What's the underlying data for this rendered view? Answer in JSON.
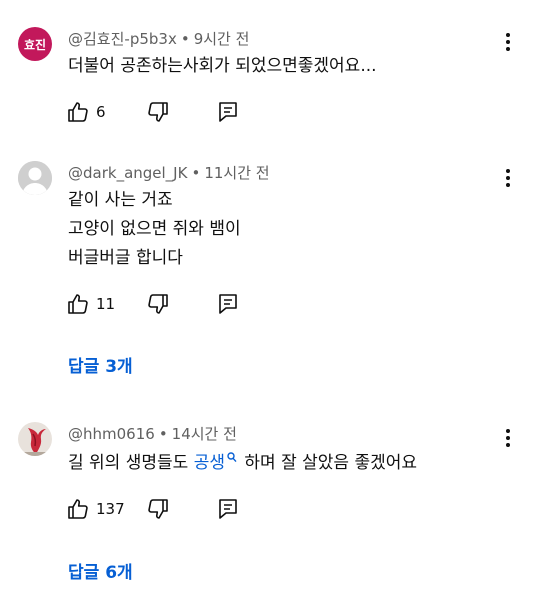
{
  "comments": [
    {
      "avatar_text": "효진",
      "author": "@김효진-p5b3x",
      "time": "9시간 전",
      "lines": [
        "더불어 공존하는사회가 되었으면좋겠어요..."
      ],
      "likes": "6"
    },
    {
      "author": "@dark_angel_JK",
      "time": "11시간 전",
      "lines": [
        "같이 사는 거죠",
        "고양이 없으면 쥐와 뱀이",
        "버글버글 합니다"
      ],
      "likes": "11",
      "replies_label": "답글 3개"
    },
    {
      "author": "@hhm0616",
      "time": "14시간 전",
      "text_before": "길 위의 생명들도 ",
      "link_text": "공생",
      "text_after": " 하며 잘 살았음 좋겠어요",
      "likes": "137",
      "replies_label": "답글 6개"
    }
  ],
  "icons": {
    "like": "thumbs-up-icon",
    "dislike": "thumbs-down-icon",
    "reply": "reply-icon",
    "more": "more-vert-icon",
    "search": "search-icon"
  },
  "colors": {
    "link": "#065fd4",
    "meta": "#606060",
    "avatar_pink": "#c2185b"
  }
}
